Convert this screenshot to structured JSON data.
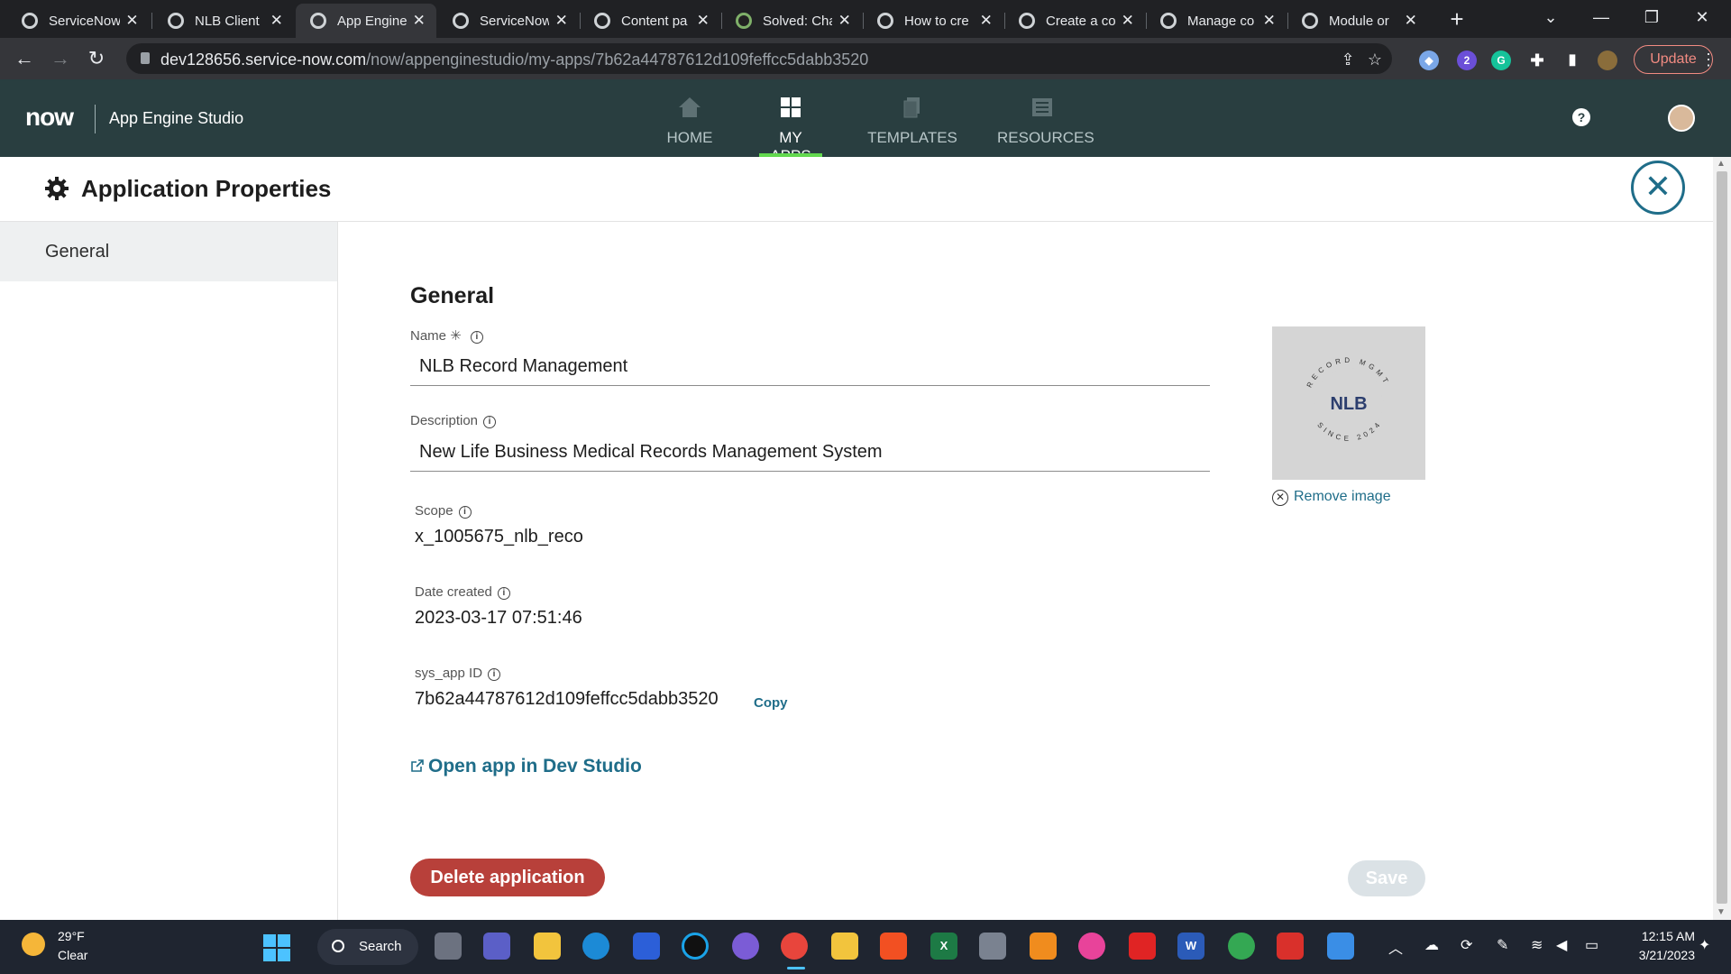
{
  "browser": {
    "tabs": [
      {
        "title": "ServiceNow",
        "active": false
      },
      {
        "title": "NLB Client",
        "active": false
      },
      {
        "title": "App Engine",
        "active": true
      },
      {
        "title": "ServiceNow",
        "active": false
      },
      {
        "title": "Content pa",
        "active": false
      },
      {
        "title": "Solved: Cha",
        "active": false
      },
      {
        "title": "How to cre",
        "active": false
      },
      {
        "title": "Create a co",
        "active": false
      },
      {
        "title": "Manage co",
        "active": false
      },
      {
        "title": "Module or",
        "active": false
      }
    ],
    "url_host": "dev128656.service-now.com",
    "url_path": "/now/appenginestudio/my-apps/7b62a44787612d109feffcc5dabb3520",
    "update_label": "Update",
    "extension_badge": "2"
  },
  "app_header": {
    "logo": "now",
    "title": "App Engine Studio",
    "nav": [
      {
        "label": "HOME",
        "icon": "home-icon",
        "active": false
      },
      {
        "label": "MY APPS",
        "icon": "grid-icon",
        "active": true
      },
      {
        "label": "TEMPLATES",
        "icon": "templates-icon",
        "active": false
      },
      {
        "label": "RESOURCES",
        "icon": "resources-icon",
        "active": false
      }
    ],
    "help_label": "?"
  },
  "page": {
    "title": "Application Properties",
    "sidenav": [
      "General"
    ],
    "section_title": "General",
    "name_label": "Name",
    "name_required": "✳",
    "name_value": "NLB Record Management",
    "description_label": "Description",
    "description_value": "New Life Business Medical Records Management System",
    "scope_label": "Scope",
    "scope_value": "x_1005675_nlb_reco",
    "date_label": "Date created",
    "date_value": "2023-03-17 07:51:46",
    "sysid_label": "sys_app ID",
    "sysid_value": "7b62a44787612d109feffcc5dabb3520",
    "copy_label": "Copy",
    "open_link": "Open app in Dev Studio",
    "remove_image": "Remove image",
    "logo_text": {
      "top": "RECORD MGMT",
      "center": "NLB",
      "bottom": "SINCE 2024"
    },
    "delete_label": "Delete application",
    "save_label": "Save"
  },
  "taskbar": {
    "weather_temp": "29°F",
    "weather_desc": "Clear",
    "search_label": "Search",
    "time": "12:15 AM",
    "date": "3/21/2023"
  },
  "colors": {
    "header_bg": "#293e40",
    "accent_green": "#62d84e",
    "link_teal": "#1f6d89",
    "delete_red": "#b8403a"
  }
}
